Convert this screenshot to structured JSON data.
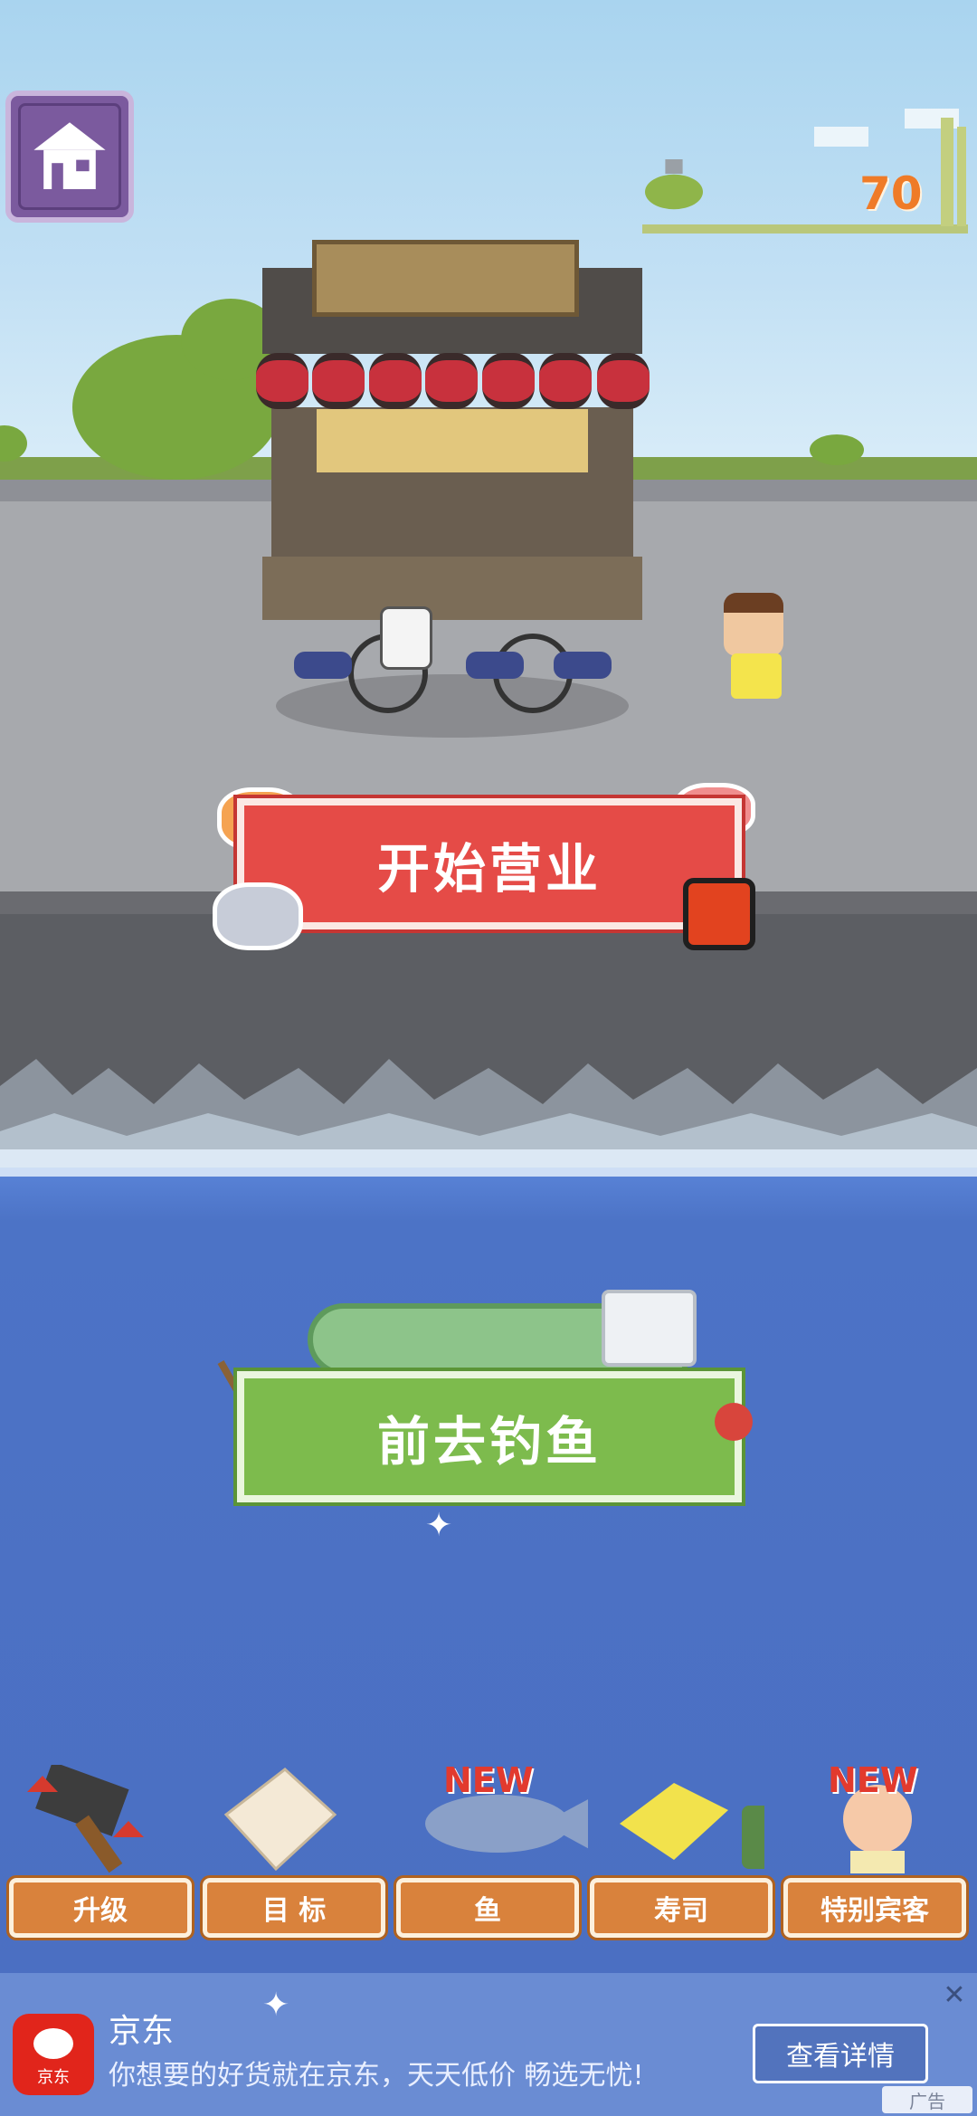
{
  "hud": {
    "home_icon": "house-icon",
    "currency_value": "70"
  },
  "actions": {
    "open_shop_label": "开始营业",
    "go_fishing_label": "前去钓鱼"
  },
  "bottom_nav": {
    "items": [
      {
        "label": "升级",
        "icon": "hammer-upgrade-icon",
        "badge": ""
      },
      {
        "label": "目  标",
        "icon": "goal-sheet-icon",
        "badge": ""
      },
      {
        "label": "鱼",
        "icon": "fish-icon",
        "badge": "NEW"
      },
      {
        "label": "寿司",
        "icon": "sushi-icon",
        "badge": ""
      },
      {
        "label": "特别宾客",
        "icon": "guest-icon",
        "badge": "NEW"
      }
    ]
  },
  "ad": {
    "brand": "京东",
    "logo_text": "京东",
    "description": "你想要的好货就在京东，天天低价 畅选无忧!",
    "cta": "查看详情",
    "tag": "广告"
  },
  "colors": {
    "open_button": "#e54b47",
    "fish_button": "#7dbb4d",
    "nav_button": "#d9823c",
    "currency": "#ef7b28"
  }
}
